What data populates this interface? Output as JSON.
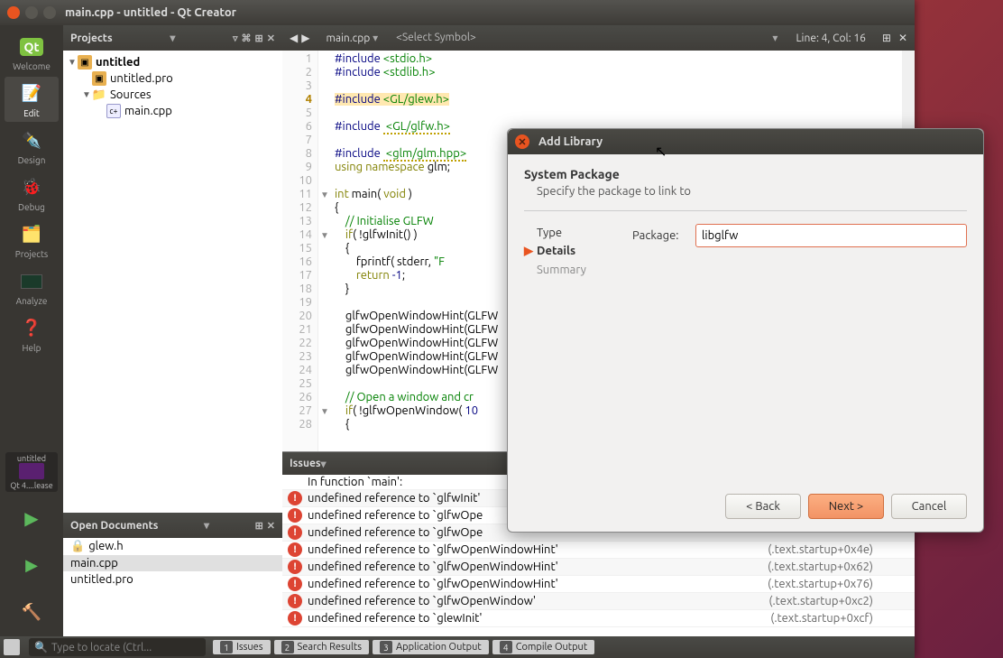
{
  "window": {
    "title": "main.cpp - untitled - Qt Creator"
  },
  "modes": {
    "welcome": "Welcome",
    "edit": "Edit",
    "design": "Design",
    "debug": "Debug",
    "projects": "Projects",
    "analyze": "Analyze",
    "help": "Help"
  },
  "kit": {
    "project": "untitled",
    "label": "Qt 4....lease"
  },
  "projects_panel": {
    "title": "Projects",
    "root": "untitled",
    "pro_file": "untitled.pro",
    "sources_folder": "Sources",
    "source_file": "main.cpp"
  },
  "open_docs": {
    "title": "Open Documents",
    "items": [
      "glew.h",
      "main.cpp",
      "untitled.pro"
    ],
    "active": 1
  },
  "editor": {
    "file": "main.cpp",
    "symbol_placeholder": "<Select Symbol>",
    "position": "Line: 4, Col: 16",
    "lines": {
      "1": "#include <stdio.h>",
      "2": "#include <stdlib.h>",
      "3": "",
      "4": "#include <GL/glew.h>",
      "5": "",
      "6": "#include <GL/glfw.h>",
      "7": "",
      "8": "#include <glm/glm.hpp>",
      "9": "using namespace glm;",
      "10": "",
      "11": "int main( void )",
      "12": "{",
      "13": "    // Initialise GLFW",
      "14": "    if( !glfwInit() )",
      "15": "    {",
      "16": "        fprintf( stderr, \"F",
      "17": "        return -1;",
      "18": "    }",
      "19": "",
      "20": "    glfwOpenWindowHint(GLFW",
      "21": "    glfwOpenWindowHint(GLFW",
      "22": "    glfwOpenWindowHint(GLFW",
      "23": "    glfwOpenWindowHint(GLFW",
      "24": "    glfwOpenWindowHint(GLFW",
      "25": "",
      "26": "    // Open a window and cr",
      "27": "    if( !glfwOpenWindow( 10",
      "28": "    {"
    }
  },
  "issues": {
    "title": "Issues",
    "header_row": "In function `main':",
    "rows": [
      {
        "msg": "undefined reference to `glfwInit'",
        "loc": ""
      },
      {
        "msg": "undefined reference to `glfwOpe",
        "loc": ""
      },
      {
        "msg": "undefined reference to `glfwOpe",
        "loc": ""
      },
      {
        "msg": "undefined reference to `glfwOpenWindowHint'",
        "loc": "(.text.startup+0x4e)"
      },
      {
        "msg": "undefined reference to `glfwOpenWindowHint'",
        "loc": "(.text.startup+0x62)"
      },
      {
        "msg": "undefined reference to `glfwOpenWindowHint'",
        "loc": "(.text.startup+0x76)"
      },
      {
        "msg": "undefined reference to `glfwOpenWindow'",
        "loc": "(.text.startup+0xc2)"
      },
      {
        "msg": "undefined reference to `glewInit'",
        "loc": "(.text.startup+0xcf)"
      }
    ]
  },
  "bottom": {
    "search_placeholder": "Type to locate (Ctrl...",
    "tabs": [
      "Issues",
      "Search Results",
      "Application Output",
      "Compile Output"
    ]
  },
  "dialog": {
    "title": "Add Library",
    "heading": "System Package",
    "subheading": "Specify the package to link to",
    "steps": {
      "type": "Type",
      "details": "Details",
      "summary": "Summary"
    },
    "package_label": "Package:",
    "package_value": "libglfw",
    "back": "< Back",
    "next": "Next >",
    "cancel": "Cancel"
  }
}
